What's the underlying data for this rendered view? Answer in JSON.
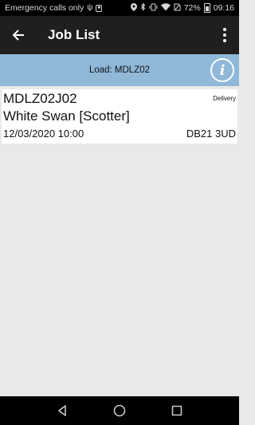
{
  "status_bar": {
    "carrier_text": "Emergency calls only",
    "battery_percent": "72%",
    "time": "09:16",
    "icons": [
      "usb-icon",
      "sim-icon",
      "location-icon",
      "bluetooth-icon",
      "vibrate-icon",
      "wifi-icon",
      "no-sim-icon",
      "battery-icon"
    ]
  },
  "app_bar": {
    "title": "Job List",
    "back_icon": "arrow-back-icon",
    "menu_icon": "more-vert-icon"
  },
  "load_header": {
    "label": "Load: MDLZ02",
    "info_icon": "info-icon"
  },
  "jobs": [
    {
      "ref": "MDLZ02J02",
      "type": "Delivery",
      "customer": "White Swan [Scotter]",
      "datetime": "12/03/2020 10:00",
      "postcode": "DB21 3UD"
    }
  ],
  "nav_bar": {
    "icons": [
      "back-triangle-icon",
      "home-circle-icon",
      "recents-square-icon"
    ]
  }
}
